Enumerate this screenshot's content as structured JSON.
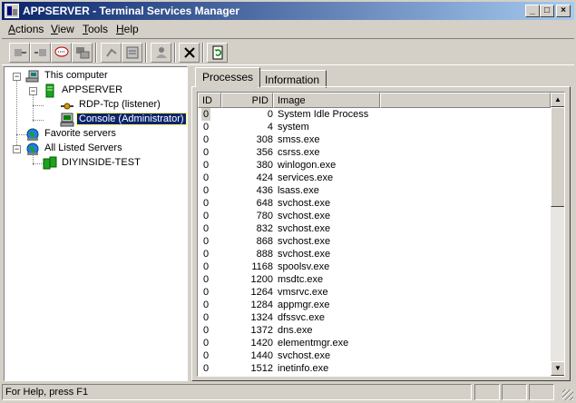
{
  "window": {
    "title": "APPSERVER - Terminal Services Manager"
  },
  "title_buttons": {
    "minimize": "_",
    "maximize": "□",
    "close": "×"
  },
  "menu": [
    {
      "label": "Actions",
      "mnemonic": "A",
      "rest": "ctions"
    },
    {
      "label": "View",
      "mnemonic": "V",
      "rest": "iew"
    },
    {
      "label": "Tools",
      "mnemonic": "T",
      "rest": "ools"
    },
    {
      "label": "Help",
      "mnemonic": "H",
      "rest": "elp"
    }
  ],
  "toolbar": [
    {
      "icon": "connect-icon"
    },
    {
      "icon": "disconnect-icon"
    },
    {
      "icon": "send-message-icon"
    },
    {
      "icon": "remote-control-icon"
    },
    {
      "icon": "reset-icon"
    },
    {
      "icon": "status-icon"
    },
    {
      "icon": "logoff-icon"
    },
    {
      "icon": "end-process-icon"
    },
    {
      "icon": "refresh-icon"
    }
  ],
  "tree": {
    "this_computer": "This computer",
    "appserver": "APPSERVER",
    "rdp": "RDP-Tcp (listener)",
    "console": "Console (Administrator)",
    "favorites": "Favorite servers",
    "all_listed": "All Listed Servers",
    "diyinside": "DIYINSIDE-TEST",
    "expand_sign": "−"
  },
  "tabs": [
    {
      "label": "Processes",
      "active": true
    },
    {
      "label": "Information",
      "active": false
    }
  ],
  "columns": {
    "id": "ID",
    "pid": "PID",
    "image": "Image"
  },
  "processes": [
    {
      "id": "0",
      "pid": "0",
      "image": "System Idle Process"
    },
    {
      "id": "0",
      "pid": "4",
      "image": "system"
    },
    {
      "id": "0",
      "pid": "308",
      "image": "smss.exe"
    },
    {
      "id": "0",
      "pid": "356",
      "image": "csrss.exe"
    },
    {
      "id": "0",
      "pid": "380",
      "image": "winlogon.exe"
    },
    {
      "id": "0",
      "pid": "424",
      "image": "services.exe"
    },
    {
      "id": "0",
      "pid": "436",
      "image": "lsass.exe"
    },
    {
      "id": "0",
      "pid": "648",
      "image": "svchost.exe"
    },
    {
      "id": "0",
      "pid": "780",
      "image": "svchost.exe"
    },
    {
      "id": "0",
      "pid": "832",
      "image": "svchost.exe"
    },
    {
      "id": "0",
      "pid": "868",
      "image": "svchost.exe"
    },
    {
      "id": "0",
      "pid": "888",
      "image": "svchost.exe"
    },
    {
      "id": "0",
      "pid": "1168",
      "image": "spoolsv.exe"
    },
    {
      "id": "0",
      "pid": "1200",
      "image": "msdtc.exe"
    },
    {
      "id": "0",
      "pid": "1264",
      "image": "vmsrvc.exe"
    },
    {
      "id": "0",
      "pid": "1284",
      "image": "appmgr.exe"
    },
    {
      "id": "0",
      "pid": "1324",
      "image": "dfssvc.exe"
    },
    {
      "id": "0",
      "pid": "1372",
      "image": "dns.exe"
    },
    {
      "id": "0",
      "pid": "1420",
      "image": "elementmgr.exe"
    },
    {
      "id": "0",
      "pid": "1440",
      "image": "svchost.exe"
    },
    {
      "id": "0",
      "pid": "1512",
      "image": "inetinfo.exe"
    }
  ],
  "scrollbar": {
    "up": "▲",
    "down": "▼"
  },
  "status": {
    "text": "For Help, press F1"
  },
  "colors": {
    "title_start": "#0a246a",
    "title_end": "#a6caf0",
    "selection": "#0a246a",
    "face": "#d4d0c8"
  }
}
